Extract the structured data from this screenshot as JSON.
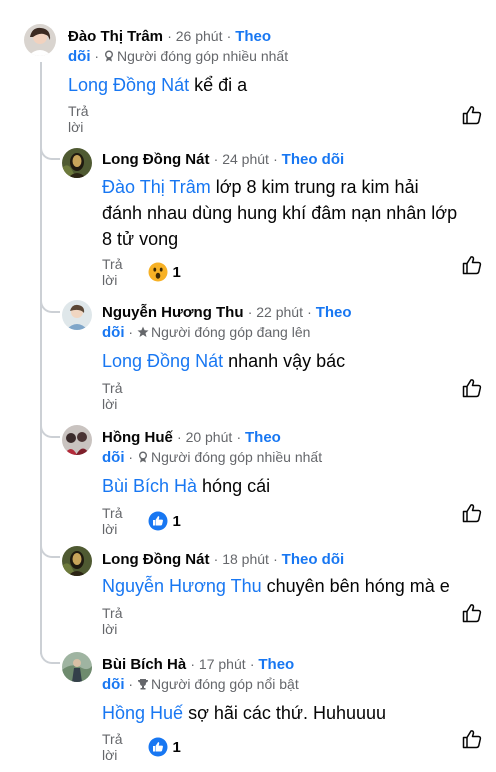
{
  "follow_label": "Theo dõi",
  "reply_label": "Trả lời",
  "colors": {
    "accent": "#1877f2",
    "meta": "#65676b",
    "thread": "#ccd0d5"
  },
  "comments": [
    {
      "author": "Đào Thị Trâm",
      "time": "26 phút",
      "follow_a": "Theo",
      "follow_b": "dõi",
      "badge_icon": "medal-icon",
      "badge": "Người đóng góp nhiều nhất",
      "mention": "Long Đồng Nát",
      "text": " kể đi a"
    },
    {
      "author": "Long Đồng Nát",
      "time": "24 phút",
      "follow": "Theo dõi",
      "mention": "Đào Thị Trâm",
      "text_line1": " lớp 8 kim trung ra kim hải",
      "text_line2": "đánh nhau dùng hung khí đâm nạn nhân lớp",
      "text_line3": "8 tử vong",
      "reaction_icon": "wow-icon",
      "reaction_count": "1"
    },
    {
      "author": "Nguyễn Hương Thu",
      "time": "22 phút",
      "follow_a": "Theo",
      "follow_b": "dõi",
      "badge_icon": "star-icon",
      "badge": "Người đóng góp đang lên",
      "mention": "Long Đồng Nát",
      "text": " nhanh vậy bác"
    },
    {
      "author": "Hồng Huế",
      "time": "20 phút",
      "follow_a": "Theo",
      "follow_b": "dõi",
      "badge_icon": "medal-icon",
      "badge": "Người đóng góp nhiều nhất",
      "mention": "Bùi Bích Hà",
      "text": " hóng cái",
      "reaction_icon": "like-icon",
      "reaction_count": "1"
    },
    {
      "author": "Long Đồng Nát",
      "time": "18 phút",
      "follow": "Theo dõi",
      "mention": "Nguyễn Hương Thu",
      "text": " chuyên bên hóng mà e"
    },
    {
      "author": "Bùi Bích Hà",
      "time": "17 phút",
      "follow_a": "Theo",
      "follow_b": "dõi",
      "badge_icon": "trophy-icon",
      "badge": "Người đóng góp nổi bật",
      "mention": "Hồng Huế",
      "text": " sợ hãi các thứ. Huhuuuu",
      "reaction_icon": "like-icon",
      "reaction_count": "1"
    }
  ]
}
